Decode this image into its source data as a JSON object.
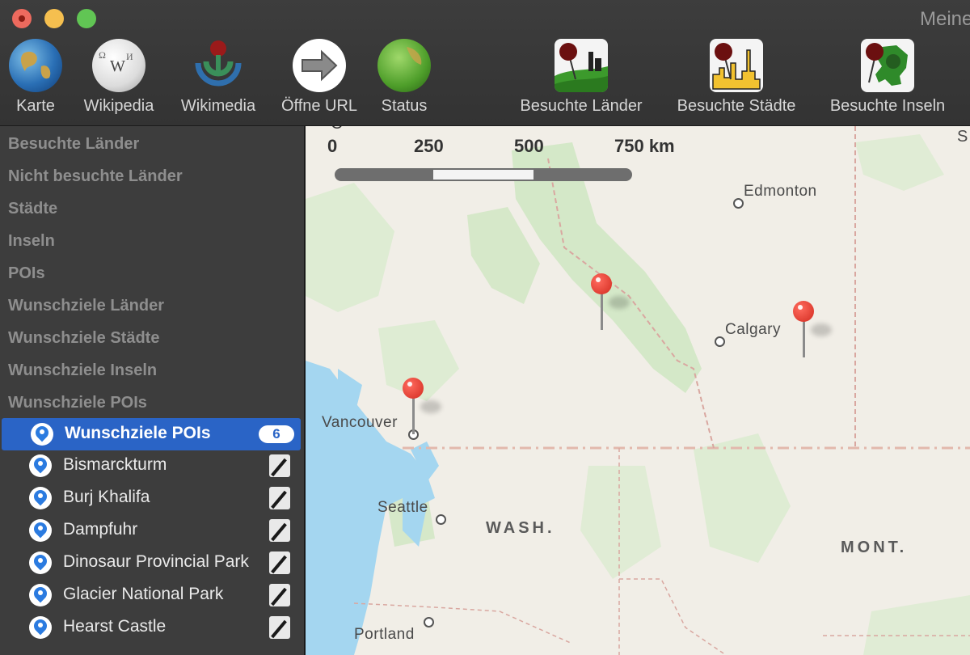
{
  "window": {
    "title": "Meine"
  },
  "toolbar": {
    "items": [
      {
        "label": "Karte",
        "icon": "globe-icon"
      },
      {
        "label": "Wikipedia",
        "icon": "wikipedia-globe-icon"
      },
      {
        "label": "Wikimedia",
        "icon": "wikimedia-icon"
      },
      {
        "label": "Öffne URL",
        "icon": "arrow-right-icon"
      },
      {
        "label": "Status",
        "icon": "status-globe-icon"
      },
      {
        "label": "Besuchte Länder",
        "icon": "visited-countries-icon"
      },
      {
        "label": "Besuchte Städte",
        "icon": "visited-cities-icon"
      },
      {
        "label": "Besuchte Inseln",
        "icon": "visited-islands-icon"
      }
    ]
  },
  "sidebar": {
    "sections": [
      "Besuchte Länder",
      "Nicht besuchte Länder",
      "Städte",
      "Inseln",
      "POIs",
      "Wunschziele Länder",
      "Wunschziele Städte",
      "Wunschziele Inseln",
      "Wunschziele POIs"
    ],
    "selected": {
      "label": "Wunschziele POIs",
      "count": "6"
    },
    "items": [
      {
        "label": "Bismarckturm"
      },
      {
        "label": "Burj Khalifa"
      },
      {
        "label": "Dampfuhr"
      },
      {
        "label": "Dinosaur Provincial Park"
      },
      {
        "label": "Glacier National Park"
      },
      {
        "label": "Hearst Castle"
      }
    ]
  },
  "map": {
    "scale": {
      "labels": [
        "0",
        "250",
        "500",
        "750 km"
      ]
    },
    "top_left_fragment": "·O·",
    "top_right_fragment": "S",
    "cities": [
      "Edmonton",
      "Calgary",
      "Vancouver",
      "Seattle",
      "Portland"
    ],
    "regions": [
      "WASH.",
      "MONT."
    ],
    "colors": {
      "land": "#f1eee7",
      "water": "#a4d6f0",
      "park": "#cfe6c2",
      "pin": "#e03a2f"
    }
  }
}
